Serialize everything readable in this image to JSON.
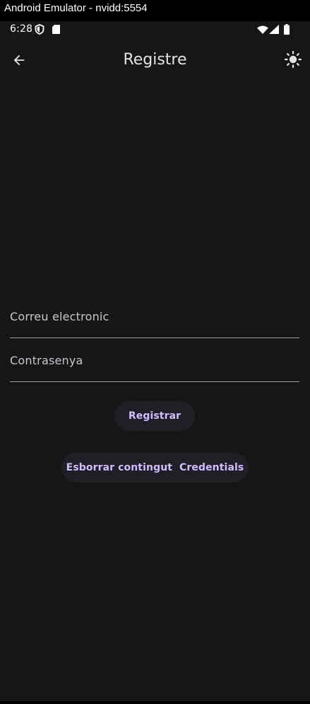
{
  "window": {
    "title": "Android Emulator - nvidd:5554"
  },
  "status_bar": {
    "time": "6:28",
    "icons": [
      "shield-icon",
      "sd-card-icon",
      "wifi-icon",
      "cell-signal-icon",
      "battery-icon"
    ]
  },
  "app_bar": {
    "title": "Registre",
    "back_icon": "arrow-back-icon",
    "theme_icon": "brightness-icon"
  },
  "form": {
    "email_label": "Correu electronic",
    "password_label": "Contrasenya",
    "register_label": "Registrar",
    "clear_label": "Esborrar contingut  Credentials"
  },
  "colors": {
    "background": "#161616",
    "button_bg": "#211f26",
    "button_text": "#d0bcff",
    "field_label": "#cac4d0",
    "title_text": "#e6e1e5",
    "underline": "#9e9e9e"
  }
}
